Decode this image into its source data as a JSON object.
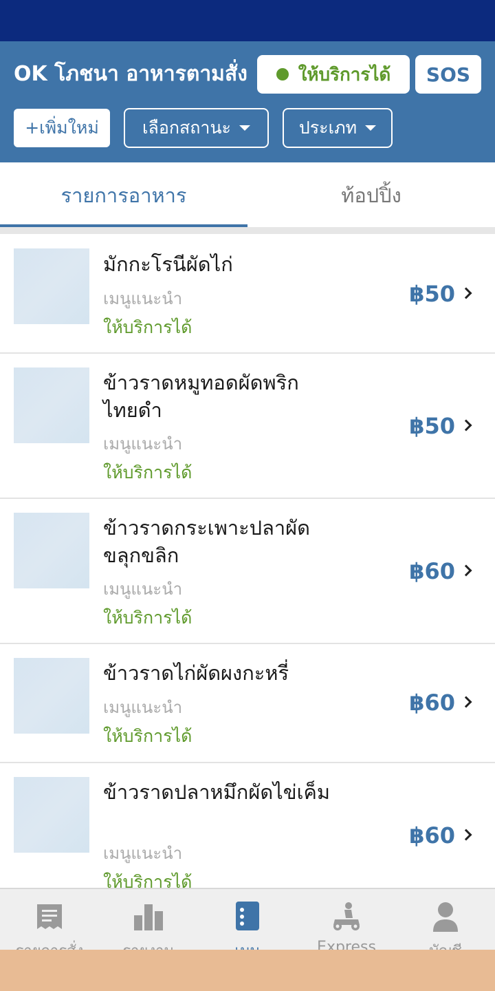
{
  "header": {
    "shop_name": "OK โภชนา อาหารตามสั่ง",
    "status_label": "ให้บริการได้",
    "sos_label": "SOS",
    "add_label": "+เพิ่มใหม่",
    "filter_status_label": "เลือกสถานะ",
    "filter_type_label": "ประเภท",
    "colors": {
      "header_bg": "#3f74a8",
      "status_bar": "#0c2a7e",
      "accent_green": "#5f9a2c"
    }
  },
  "tabs": [
    {
      "label": "รายการอาหาร",
      "active": true
    },
    {
      "label": "ท้อปปิ้ง",
      "active": false
    }
  ],
  "menu_items": [
    {
      "name": "มักกะโรนีผัดไก่",
      "tag": "เมนูแนะนำ",
      "status": "ให้บริการได้",
      "price": "฿50"
    },
    {
      "name": "ข้าวราดหมูทอดผัดพริกไทยดำ",
      "tag": "เมนูแนะนำ",
      "status": "ให้บริการได้",
      "price": "฿50"
    },
    {
      "name": "ข้าวราดกระเพาะปลาผัดขลุกขลิก",
      "tag": "เมนูแนะนำ",
      "status": "ให้บริการได้",
      "price": "฿60"
    },
    {
      "name": "ข้าวราดไก่ผัดผงกะหรี่",
      "tag": "เมนูแนะนำ",
      "status": "ให้บริการได้",
      "price": "฿60"
    },
    {
      "name": "ข้าวราดปลาหมึกผัดไข่เค็ม",
      "tag": "เมนูแนะนำ",
      "status": "ให้บริการได้",
      "price": "฿60"
    }
  ],
  "bottom_nav": [
    {
      "label": "รายการสั่ง",
      "icon": "receipt-icon",
      "active": false
    },
    {
      "label": "รายงาน",
      "icon": "bar-chart-icon",
      "active": false
    },
    {
      "label": "เมนู",
      "icon": "menu-book-icon",
      "active": true
    },
    {
      "label": "Express",
      "icon": "scooter-icon",
      "active": false
    },
    {
      "label": "บัญชี",
      "icon": "person-icon",
      "active": false
    }
  ]
}
